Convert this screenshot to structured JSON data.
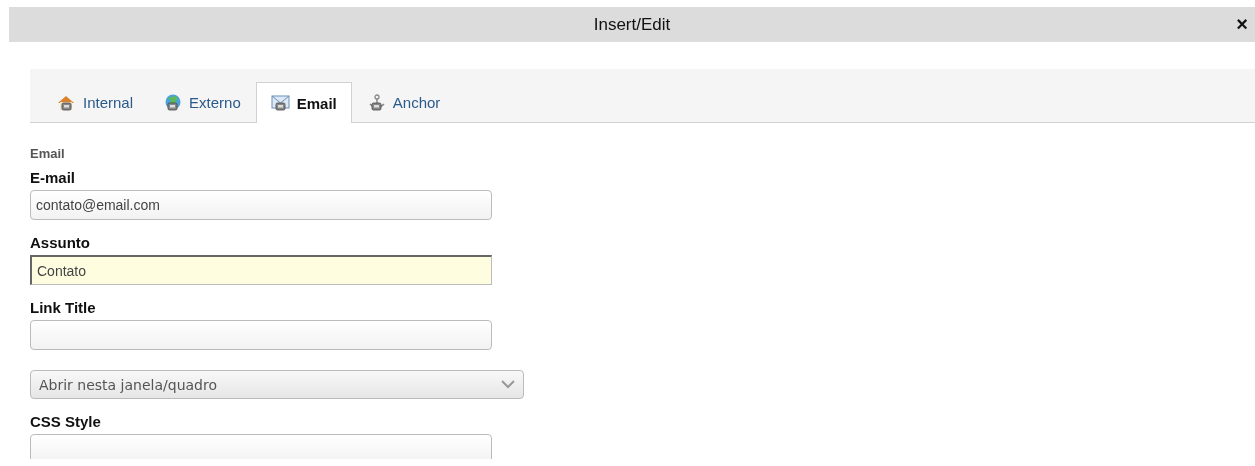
{
  "window": {
    "title": "Insert/Edit",
    "close": "×"
  },
  "tabs": [
    {
      "label": "Internal",
      "kind": "house",
      "selected": false
    },
    {
      "label": "Externo",
      "kind": "globe",
      "selected": false
    },
    {
      "label": "Email",
      "kind": "envelope",
      "selected": true
    },
    {
      "label": "Anchor",
      "kind": "anchor",
      "selected": false
    }
  ],
  "section": "Email",
  "fields": [
    {
      "kind": "text",
      "label": "E-mail",
      "value": "contato@email.com",
      "focused": false
    },
    {
      "kind": "text",
      "label": "Assunto",
      "value": "Contato",
      "focused": true
    },
    {
      "kind": "text",
      "label": "Link Title",
      "focused": false
    },
    {
      "kind": "select",
      "value": "Abrir nesta janela/quadro"
    },
    {
      "kind": "text",
      "label": "CSS Style",
      "focused": false
    }
  ]
}
